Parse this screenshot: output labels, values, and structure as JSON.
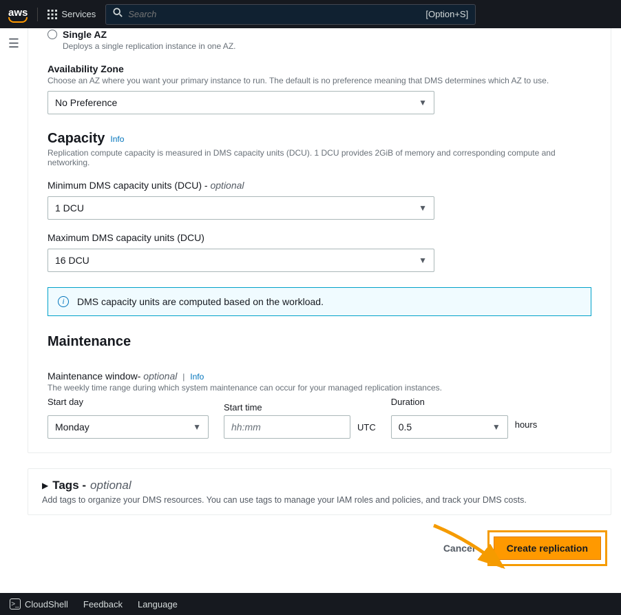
{
  "nav": {
    "logo": "aws",
    "services": "Services",
    "search_placeholder": "Search",
    "shortcut": "[Option+S]"
  },
  "content": {
    "single_az_title": "Single AZ",
    "single_az_desc": "Deploys a single replication instance in one AZ.",
    "az_label": "Availability Zone",
    "az_desc": "Choose an AZ where you want your primary instance to run. The default is no preference meaning that DMS determines which AZ to use.",
    "az_value": "No Preference",
    "capacity_title": "Capacity",
    "info_label": "Info",
    "capacity_desc": "Replication compute capacity is measured in DMS capacity units (DCU). 1 DCU provides 2GiB of memory and corresponding compute and networking.",
    "min_dcu_label": "Minimum DMS capacity units (DCU) - ",
    "optional": "optional",
    "min_dcu_value": "1 DCU",
    "max_dcu_label": "Maximum DMS capacity units (DCU)",
    "max_dcu_value": "16 DCU",
    "infobox": "DMS capacity units are computed based on the workload.",
    "maintenance_title": "Maintenance",
    "maint_window_label": "Maintenance window- ",
    "maint_window_desc": "The weekly time range during which system maintenance can occur for your managed replication instances.",
    "start_day_label": "Start day",
    "start_day_value": "Monday",
    "start_time_label": "Start time",
    "start_time_placeholder": "hh:mm",
    "utc": "UTC",
    "duration_label": "Duration",
    "duration_value": "0.5",
    "hours": "hours"
  },
  "tags": {
    "title": "Tags - ",
    "optional": "optional",
    "desc": "Add tags to organize your DMS resources. You can use tags to manage your IAM roles and policies, and track your DMS costs."
  },
  "actions": {
    "cancel": "Cancel",
    "create": "Create replication"
  },
  "footer": {
    "cloudshell": "CloudShell",
    "feedback": "Feedback",
    "language": "Language"
  }
}
